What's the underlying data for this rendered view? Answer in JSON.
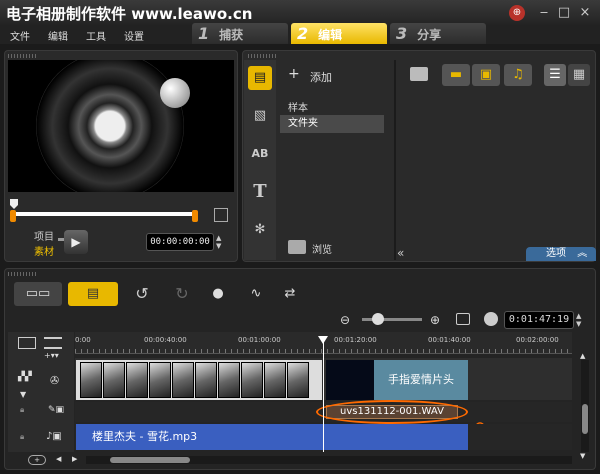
{
  "app": {
    "title": "电子相册制作软件 www.leawo.cn",
    "win_buttons": [
      "×"
    ]
  },
  "menu": [
    "文件",
    "编辑",
    "工具",
    "设置"
  ],
  "steps": [
    {
      "num": "1",
      "label": "捕获"
    },
    {
      "num": "2",
      "label": "编辑"
    },
    {
      "num": "3",
      "label": "分享"
    }
  ],
  "player": {
    "project_label": "项目",
    "clip_label": "素材",
    "timecode": "00:00:00:00"
  },
  "library": {
    "add_label": "添加",
    "categories": [
      "样本",
      "文件夹"
    ],
    "browse_label": "浏览",
    "options_label": "选项"
  },
  "timeline": {
    "timecode": "0:01:47:19",
    "ticks": [
      "0:00",
      "00:00:40:00",
      "00:01:00:00",
      "00:01:20:00",
      "00:01:40:00",
      "00:02:00:00"
    ],
    "title_clip": "手指爱情片头",
    "audio_clip": "uvs131112-001.WAV",
    "music_clip": "楼里杰夫 - 雪花.mp3"
  },
  "colors": {
    "accent": "#f0b400",
    "active_tab": "#e8b800",
    "music_track": "#3a5fc0",
    "highlight": "#ff6a00"
  }
}
